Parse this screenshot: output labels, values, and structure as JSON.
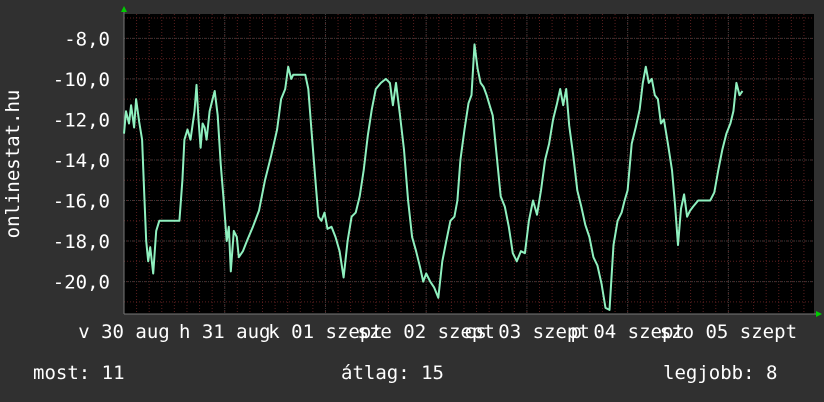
{
  "chart_data": {
    "type": "line",
    "ylabel": "onlinestat.hu",
    "y_ticks": [
      "-8,0",
      "-10,0",
      "-12,0",
      "-14,0",
      "-16,0",
      "-18,0",
      "-20,0"
    ],
    "y_tick_values": [
      -8,
      -10,
      -12,
      -14,
      -16,
      -18,
      -20
    ],
    "ylim": [
      -21.6,
      -6.8
    ],
    "x_tick_labels": [
      "v 30 aug",
      "h 31 aug",
      "k 01 szept",
      "sze 02 szept",
      "cs 03 szept",
      "p 04 szept",
      "szo 05 szept"
    ],
    "x_tick_positions_days": [
      0,
      1,
      2,
      3,
      4,
      5,
      6
    ],
    "xlim_days": [
      0,
      6.85
    ],
    "grid": true,
    "colors": {
      "background": "#303030",
      "plot": "#000000",
      "line": "#8ff0bf",
      "grid_major": "#3a3a3a",
      "grid_minor": "#5a1f1f",
      "axis_arrow": "#00cc00"
    },
    "series": [
      {
        "values": [
          [
            0.0,
            -12.7
          ],
          [
            0.02,
            -11.6
          ],
          [
            0.05,
            -12.2
          ],
          [
            0.07,
            -11.3
          ],
          [
            0.1,
            -12.4
          ],
          [
            0.12,
            -11.0
          ],
          [
            0.15,
            -12.1
          ],
          [
            0.18,
            -13.0
          ],
          [
            0.2,
            -15.5
          ],
          [
            0.22,
            -18.0
          ],
          [
            0.24,
            -19.0
          ],
          [
            0.26,
            -18.3
          ],
          [
            0.29,
            -19.6
          ],
          [
            0.32,
            -17.5
          ],
          [
            0.35,
            -17.0
          ],
          [
            0.4,
            -17.0
          ],
          [
            0.48,
            -17.0
          ],
          [
            0.55,
            -17.0
          ],
          [
            0.58,
            -15.0
          ],
          [
            0.6,
            -13.0
          ],
          [
            0.63,
            -12.5
          ],
          [
            0.66,
            -13.0
          ],
          [
            0.7,
            -11.6
          ],
          [
            0.72,
            -10.3
          ],
          [
            0.74,
            -12.0
          ],
          [
            0.76,
            -13.4
          ],
          [
            0.78,
            -12.2
          ],
          [
            0.8,
            -12.4
          ],
          [
            0.82,
            -13.0
          ],
          [
            0.85,
            -11.6
          ],
          [
            0.88,
            -11.0
          ],
          [
            0.9,
            -10.6
          ],
          [
            0.93,
            -11.8
          ],
          [
            0.96,
            -14.2
          ],
          [
            0.99,
            -16.0
          ],
          [
            1.02,
            -18.0
          ],
          [
            1.04,
            -17.3
          ],
          [
            1.06,
            -19.5
          ],
          [
            1.09,
            -17.5
          ],
          [
            1.12,
            -17.8
          ],
          [
            1.14,
            -18.8
          ],
          [
            1.18,
            -18.5
          ],
          [
            1.22,
            -18.0
          ],
          [
            1.28,
            -17.3
          ],
          [
            1.34,
            -16.5
          ],
          [
            1.4,
            -15.0
          ],
          [
            1.46,
            -13.8
          ],
          [
            1.52,
            -12.5
          ],
          [
            1.56,
            -11.0
          ],
          [
            1.6,
            -10.5
          ],
          [
            1.63,
            -9.4
          ],
          [
            1.66,
            -10.0
          ],
          [
            1.68,
            -9.8
          ],
          [
            1.72,
            -9.8
          ],
          [
            1.76,
            -9.8
          ],
          [
            1.8,
            -9.8
          ],
          [
            1.83,
            -10.5
          ],
          [
            1.86,
            -12.5
          ],
          [
            1.9,
            -15.0
          ],
          [
            1.93,
            -16.8
          ],
          [
            1.96,
            -17.0
          ],
          [
            1.99,
            -16.6
          ],
          [
            2.02,
            -17.4
          ],
          [
            2.06,
            -17.3
          ],
          [
            2.1,
            -17.8
          ],
          [
            2.14,
            -18.5
          ],
          [
            2.18,
            -19.8
          ],
          [
            2.22,
            -18.0
          ],
          [
            2.26,
            -16.8
          ],
          [
            2.3,
            -16.6
          ],
          [
            2.34,
            -15.8
          ],
          [
            2.38,
            -14.5
          ],
          [
            2.42,
            -12.8
          ],
          [
            2.46,
            -11.5
          ],
          [
            2.5,
            -10.5
          ],
          [
            2.55,
            -10.2
          ],
          [
            2.6,
            -10.0
          ],
          [
            2.64,
            -10.2
          ],
          [
            2.67,
            -11.3
          ],
          [
            2.7,
            -10.2
          ],
          [
            2.74,
            -11.8
          ],
          [
            2.78,
            -13.5
          ],
          [
            2.82,
            -16.0
          ],
          [
            2.86,
            -17.8
          ],
          [
            2.9,
            -18.5
          ],
          [
            2.94,
            -19.3
          ],
          [
            2.97,
            -20.0
          ],
          [
            3.0,
            -19.6
          ],
          [
            3.04,
            -20.0
          ],
          [
            3.08,
            -20.3
          ],
          [
            3.12,
            -20.8
          ],
          [
            3.16,
            -19.0
          ],
          [
            3.2,
            -18.0
          ],
          [
            3.24,
            -17.0
          ],
          [
            3.28,
            -16.8
          ],
          [
            3.31,
            -16.0
          ],
          [
            3.34,
            -14.0
          ],
          [
            3.38,
            -12.5
          ],
          [
            3.42,
            -11.2
          ],
          [
            3.45,
            -10.8
          ],
          [
            3.48,
            -8.3
          ],
          [
            3.51,
            -9.5
          ],
          [
            3.54,
            -10.2
          ],
          [
            3.57,
            -10.4
          ],
          [
            3.6,
            -10.8
          ],
          [
            3.63,
            -11.3
          ],
          [
            3.66,
            -11.8
          ],
          [
            3.7,
            -13.8
          ],
          [
            3.74,
            -15.8
          ],
          [
            3.78,
            -16.3
          ],
          [
            3.82,
            -17.3
          ],
          [
            3.86,
            -18.6
          ],
          [
            3.9,
            -19.0
          ],
          [
            3.94,
            -18.5
          ],
          [
            3.98,
            -18.6
          ],
          [
            4.02,
            -17.0
          ],
          [
            4.06,
            -16.0
          ],
          [
            4.1,
            -16.7
          ],
          [
            4.14,
            -15.5
          ],
          [
            4.18,
            -14.0
          ],
          [
            4.22,
            -13.2
          ],
          [
            4.26,
            -12.0
          ],
          [
            4.3,
            -11.2
          ],
          [
            4.33,
            -10.5
          ],
          [
            4.36,
            -11.3
          ],
          [
            4.39,
            -10.5
          ],
          [
            4.42,
            -12.3
          ],
          [
            4.46,
            -13.8
          ],
          [
            4.5,
            -15.5
          ],
          [
            4.54,
            -16.3
          ],
          [
            4.58,
            -17.2
          ],
          [
            4.62,
            -17.8
          ],
          [
            4.66,
            -18.8
          ],
          [
            4.7,
            -19.2
          ],
          [
            4.74,
            -20.1
          ],
          [
            4.78,
            -21.3
          ],
          [
            4.82,
            -21.4
          ],
          [
            4.86,
            -18.2
          ],
          [
            4.9,
            -17.0
          ],
          [
            4.94,
            -16.6
          ],
          [
            4.97,
            -16.0
          ],
          [
            5.0,
            -15.5
          ],
          [
            5.04,
            -13.2
          ],
          [
            5.08,
            -12.4
          ],
          [
            5.12,
            -11.5
          ],
          [
            5.15,
            -10.2
          ],
          [
            5.18,
            -9.4
          ],
          [
            5.21,
            -10.2
          ],
          [
            5.24,
            -10.0
          ],
          [
            5.27,
            -10.8
          ],
          [
            5.3,
            -11.0
          ],
          [
            5.33,
            -12.2
          ],
          [
            5.36,
            -12.0
          ],
          [
            5.4,
            -13.2
          ],
          [
            5.44,
            -14.5
          ],
          [
            5.47,
            -16.2
          ],
          [
            5.5,
            -18.2
          ],
          [
            5.53,
            -16.4
          ],
          [
            5.56,
            -15.7
          ],
          [
            5.59,
            -16.8
          ],
          [
            5.62,
            -16.5
          ],
          [
            5.65,
            -16.3
          ],
          [
            5.7,
            -16.0
          ],
          [
            5.76,
            -16.0
          ],
          [
            5.82,
            -16.0
          ],
          [
            5.86,
            -15.6
          ],
          [
            5.9,
            -14.5
          ],
          [
            5.94,
            -13.5
          ],
          [
            5.98,
            -12.7
          ],
          [
            6.02,
            -12.2
          ],
          [
            6.05,
            -11.6
          ],
          [
            6.08,
            -10.2
          ],
          [
            6.11,
            -10.8
          ],
          [
            6.14,
            -10.6
          ]
        ]
      }
    ]
  },
  "footer": {
    "now_text": "most: 11",
    "avg_text": "átlag: 15",
    "best_text": "legjobb: 8"
  }
}
